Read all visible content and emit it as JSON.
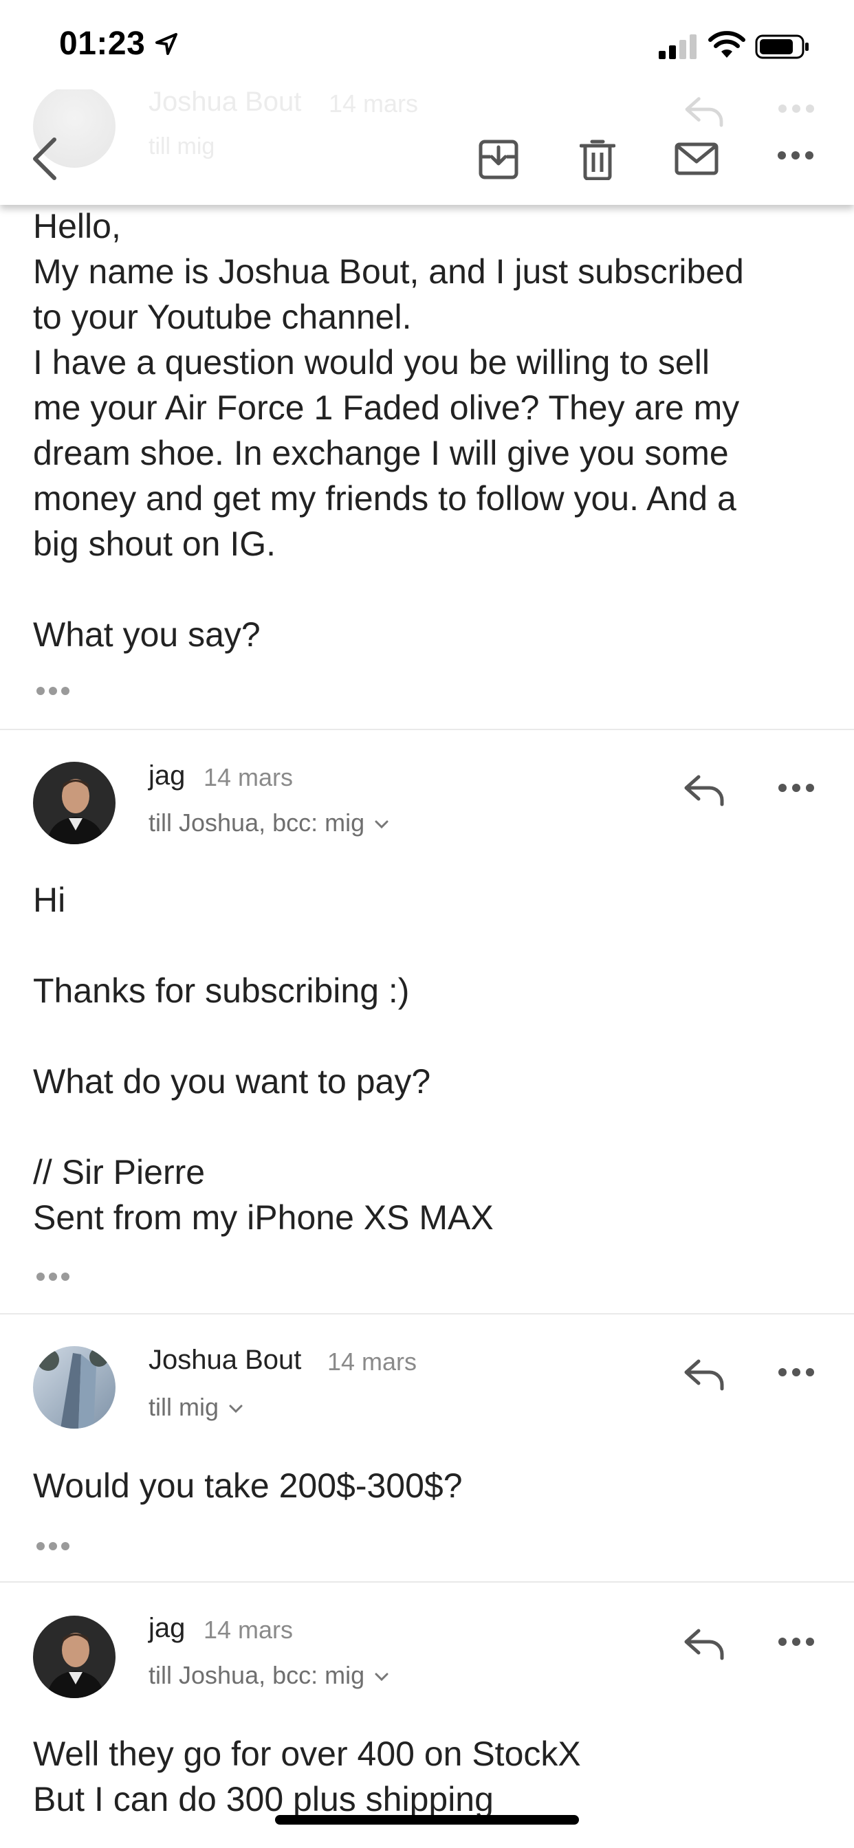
{
  "status_bar": {
    "time": "01:23"
  },
  "ghost_header": {
    "sender": "Joshua Bout",
    "date": "14 mars",
    "to": "till mig"
  },
  "toolbar": {
    "back_icon": "chevron-left-icon",
    "archive_icon": "archive-icon",
    "trash_icon": "trash-icon",
    "mail_icon": "envelope-icon",
    "more_icon": "more-horizontal-icon"
  },
  "messages": [
    {
      "body": "Hello,\nMy name is Joshua Bout, and I just subscribed\nto your Youtube channel.\nI have a question would you be willing to sell\nme your Air Force 1 Faded olive? They are my\ndream shoe. In exchange I will give you some\nmoney and get my friends to follow you. And a\nbig shout on IG.\n\nWhat you say?"
    },
    {
      "sender": "jag",
      "date": "14 mars",
      "to": "till Joshua, bcc: mig",
      "body": "Hi\n\nThanks for subscribing :)\n\nWhat do you want to pay?\n\n// Sir Pierre\nSent from my iPhone XS MAX"
    },
    {
      "sender": "Joshua Bout",
      "date": "14 mars",
      "to": "till mig",
      "body": "Would you take 200$-300$?"
    },
    {
      "sender": "jag",
      "date": "14 mars",
      "to": "till Joshua, bcc: mig",
      "body": "Well they go for over 400 on StockX\nBut I can do 300 plus shipping"
    }
  ]
}
